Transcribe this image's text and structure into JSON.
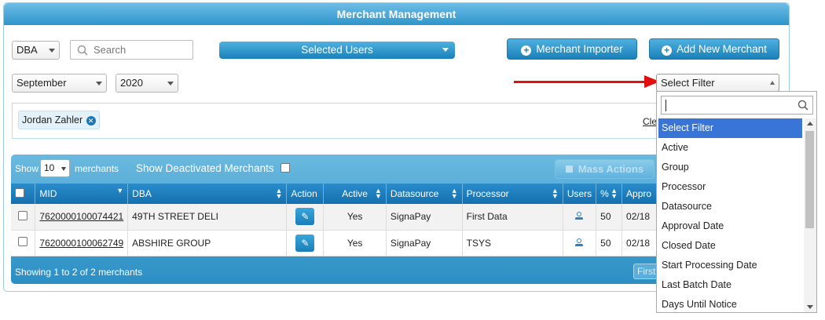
{
  "panel": {
    "title": "Merchant Management"
  },
  "controls": {
    "type_select": "DBA",
    "search": {
      "value": "",
      "placeholder": "Search"
    },
    "selected_users": "Selected Users",
    "merchant_importer": "Merchant Importer",
    "add_new_merchant": "Add New Merchant",
    "month": "September",
    "year": "2020"
  },
  "tags": [
    {
      "label": "Jordan Zahler"
    }
  ],
  "clear_link": "Clear",
  "table_toolbar": {
    "show": "Show",
    "page_size": "10",
    "merchants": "merchants",
    "show_deactivated": "Show Deactivated Merchants",
    "mass_actions": "Mass Actions"
  },
  "table": {
    "columns": [
      "MID",
      "DBA",
      "Action",
      "Active",
      "Datasource",
      "Processor",
      "Users",
      "%",
      "Appro"
    ],
    "rows": [
      {
        "mid": "7620000100074421",
        "dba": "49TH STREET DELI",
        "active": "Yes",
        "datasource": "SignaPay",
        "processor": "First Data",
        "percent": "50",
        "approval": "02/18"
      },
      {
        "mid": "7620000100062749",
        "dba": "ABSHIRE GROUP",
        "active": "Yes",
        "datasource": "SignaPay",
        "processor": "TSYS",
        "percent": "50",
        "approval": "02/18"
      }
    ]
  },
  "table_footer": {
    "summary": "Showing 1 to 2 of 2 merchants",
    "first": "First"
  },
  "filter": {
    "selected": "Select Filter",
    "search_value": "",
    "options": [
      "Select Filter",
      "Active",
      "Group",
      "Processor",
      "Datasource",
      "Approval Date",
      "Closed Date",
      "Start Processing Date",
      "Last Batch Date",
      "Days Until Notice"
    ]
  },
  "colors": {
    "header_blue": "#2f95cb",
    "button_blue": "#1a80b9",
    "highlight": "#3875d7",
    "annotation_arrow": "#e01010"
  },
  "icons": {
    "search": "magnifier",
    "add": "circle-plus",
    "tag_remove": "circle-x",
    "edit": "pencil",
    "users": "user-silhouette",
    "mass_actions": "floppy-disk"
  }
}
